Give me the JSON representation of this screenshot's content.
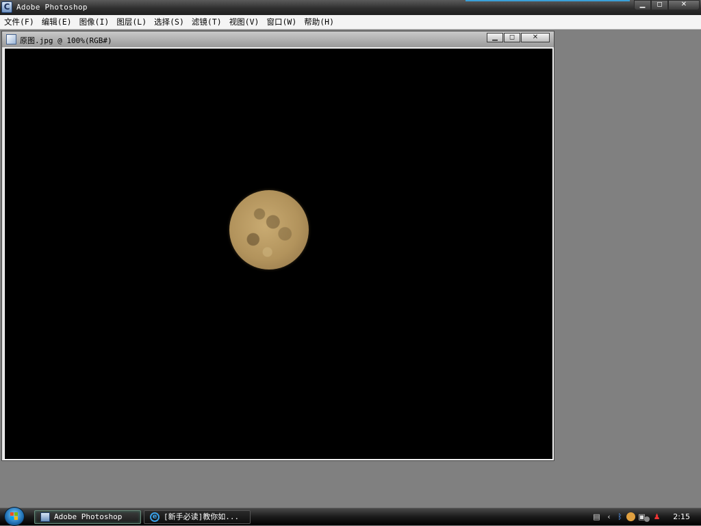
{
  "app": {
    "title": "Adobe Photoshop",
    "icon": "photoshop-icon",
    "controls": {
      "minimize": "▁",
      "restore": "◻",
      "close": "✕"
    }
  },
  "menubar": {
    "items": [
      {
        "label": "文件(F)"
      },
      {
        "label": "编辑(E)"
      },
      {
        "label": "图像(I)"
      },
      {
        "label": "图层(L)"
      },
      {
        "label": "选择(S)"
      },
      {
        "label": "滤镜(T)"
      },
      {
        "label": "视图(V)"
      },
      {
        "label": "窗口(W)"
      },
      {
        "label": "帮助(H)"
      }
    ]
  },
  "document": {
    "title": "原图.jpg @ 100%(RGB#)",
    "controls": {
      "minimize": "▁",
      "restore": "◻",
      "close": "✕"
    },
    "canvas_background": "#000000"
  },
  "taskbar": {
    "buttons": [
      {
        "label": "Adobe Photoshop",
        "icon": "photoshop-icon",
        "active": true
      },
      {
        "label": "[新手必读]教你如...",
        "icon": "internet-explorer-icon",
        "active": false
      }
    ],
    "tray": {
      "icons": [
        "keyboard-icon",
        "chevron-left-icon",
        "bluetooth-icon",
        "messenger-icon",
        "network-icon",
        "volume-icon",
        "qq-penguin-icon"
      ],
      "clock": "2:15"
    }
  }
}
